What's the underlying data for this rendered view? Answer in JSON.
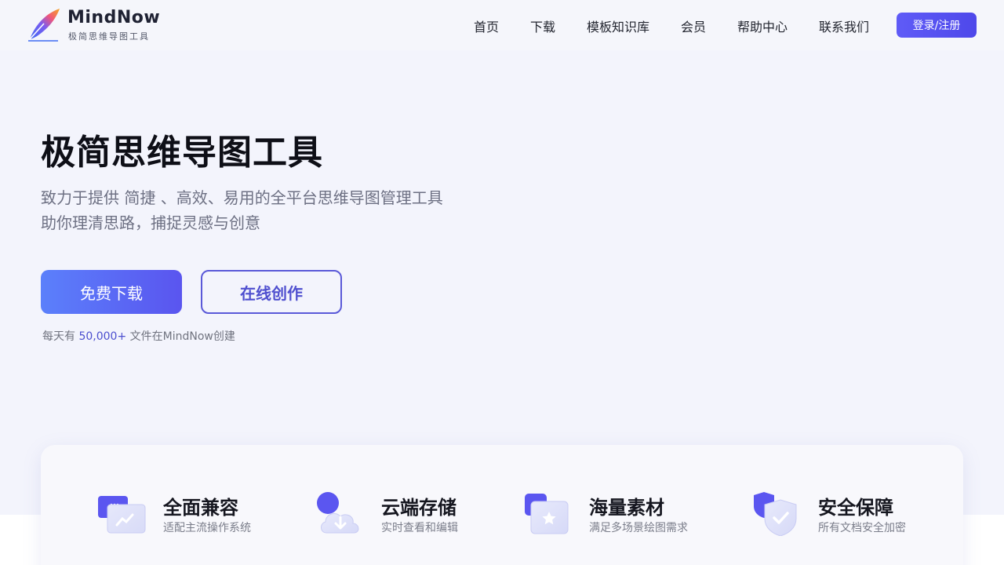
{
  "brand": {
    "name": "MindNow",
    "tagline": "极简思维导图工具",
    "colors": {
      "accent": "#5b56f0",
      "accent_light": "#5b80fb"
    }
  },
  "nav": {
    "items": [
      {
        "label": "首页"
      },
      {
        "label": "下载"
      },
      {
        "label": "模板知识库"
      },
      {
        "label": "会员"
      },
      {
        "label": "帮助中心"
      },
      {
        "label": "联系我们"
      }
    ],
    "login_label": "登录/注册"
  },
  "hero": {
    "title": "极简思维导图工具",
    "desc_line1": "致力于提供 简捷 、高效、易用的全平台思维导图管理工具",
    "desc_line2": "助你理清思路，捕捉灵感与创意",
    "download_label": "免费下载",
    "online_label": "在线创作",
    "stat_prefix": "每天有 ",
    "stat_count": "50,000+",
    "stat_suffix": " 文件在MindNow创建"
  },
  "features": [
    {
      "icon": "devices-icon",
      "title": "全面兼容",
      "desc": "适配主流操作系统"
    },
    {
      "icon": "cloud-download-icon",
      "title": "云端存储",
      "desc": "实时查看和编辑"
    },
    {
      "icon": "star-folder-icon",
      "title": "海量素材",
      "desc": "满足多场景绘图需求"
    },
    {
      "icon": "shield-check-icon",
      "title": "安全保障",
      "desc": "所有文档安全加密"
    }
  ]
}
